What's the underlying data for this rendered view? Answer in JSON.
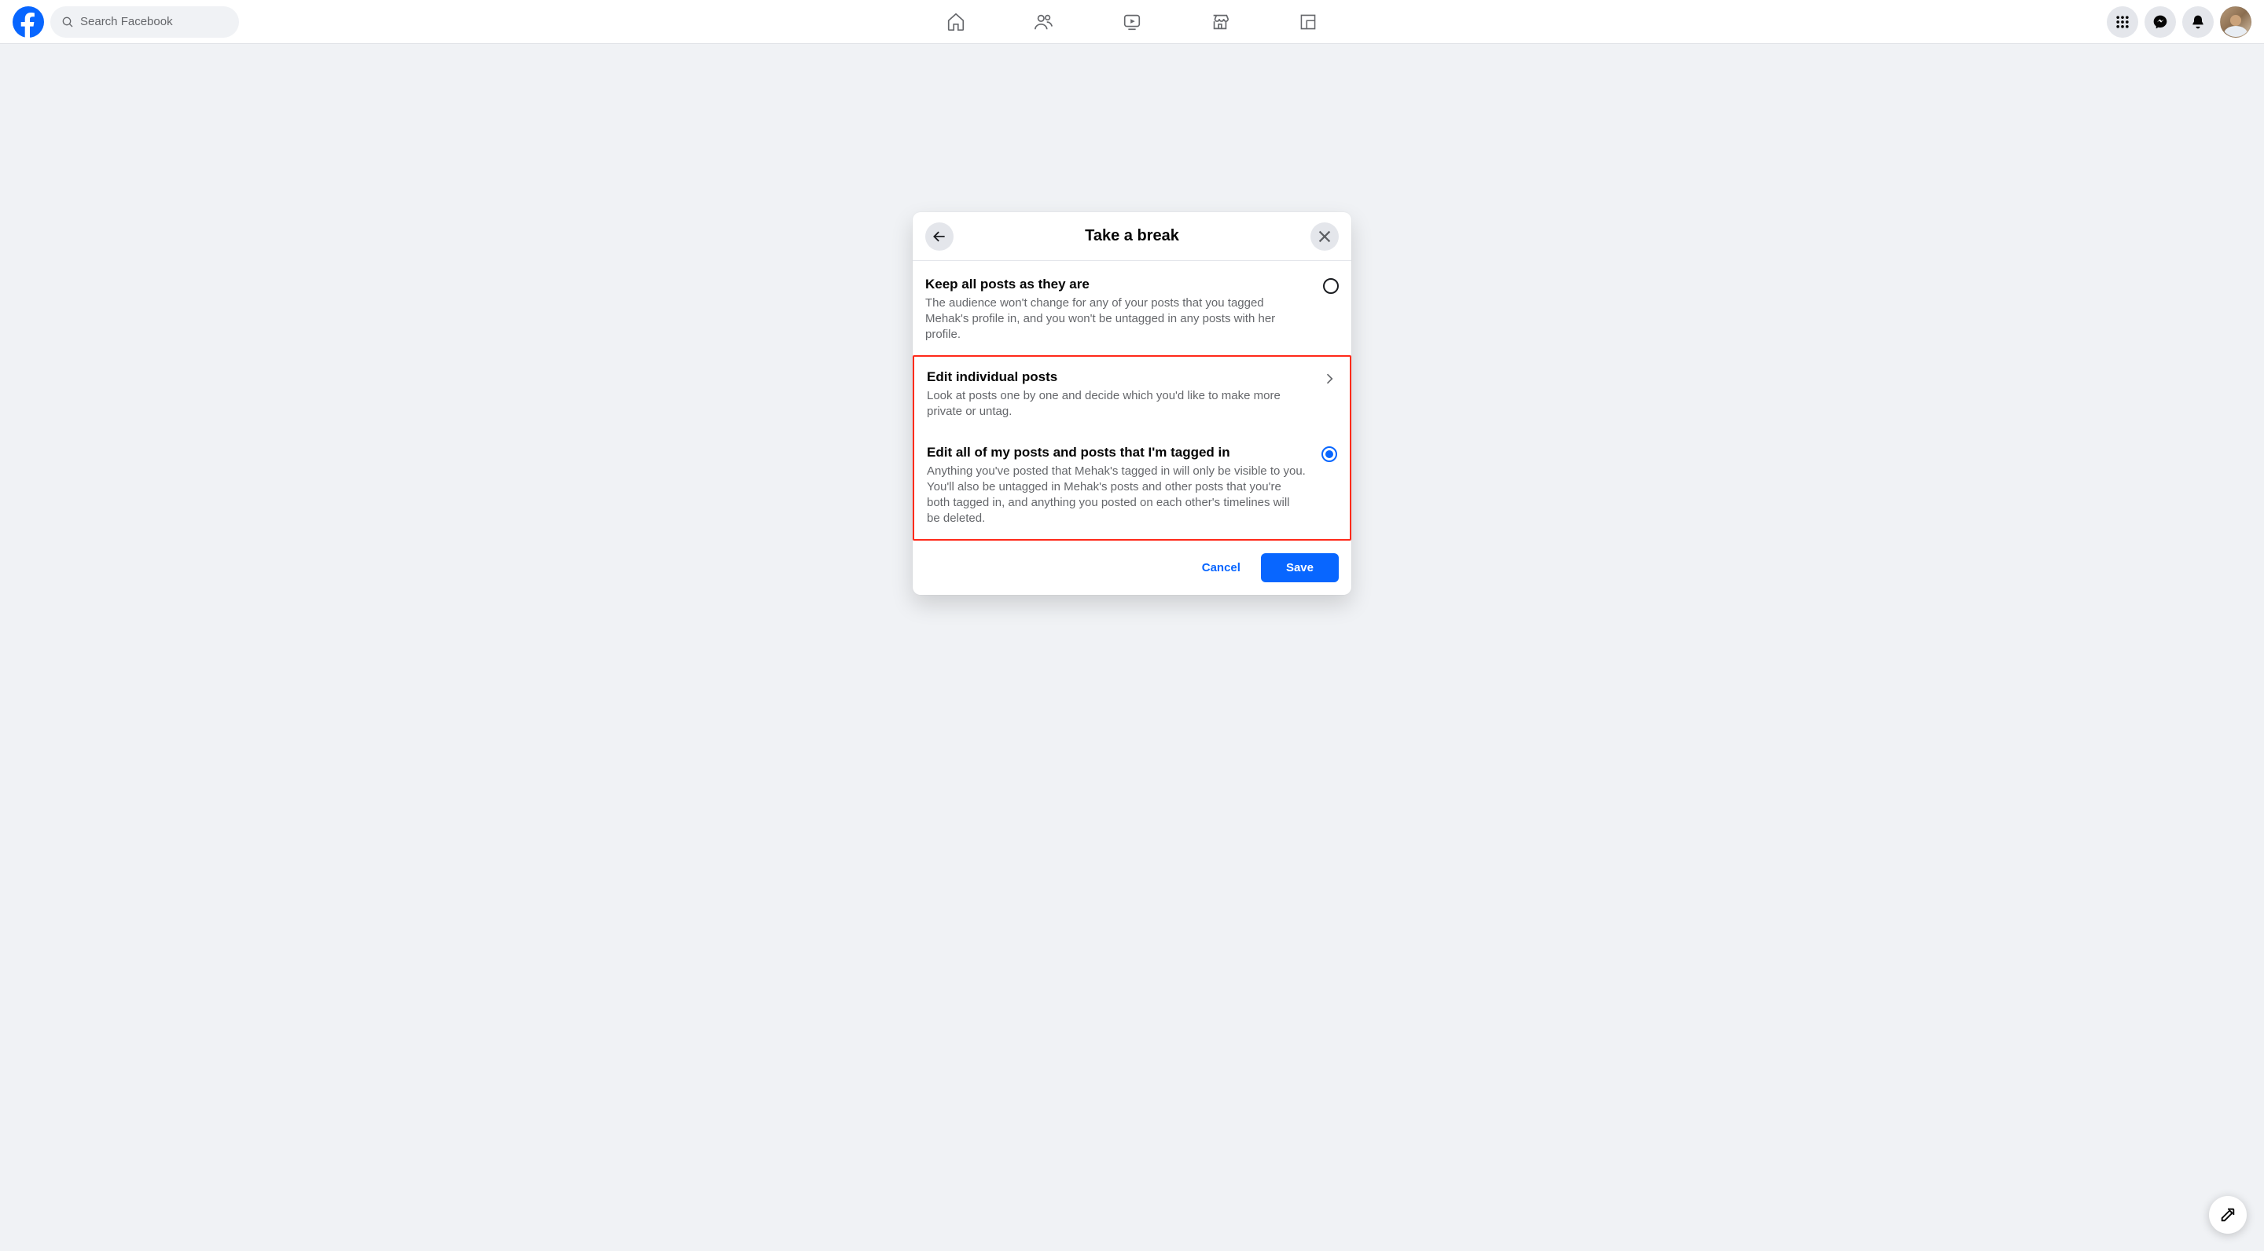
{
  "header": {
    "search_placeholder": "Search Facebook"
  },
  "dialog": {
    "title": "Take a break",
    "options": [
      {
        "title": "Keep all posts as they are",
        "desc": "The audience won't change for any of your posts that you tagged Mehak's profile in, and you won't be untagged in any posts with her profile.",
        "control": "radio",
        "selected": false
      },
      {
        "title": "Edit individual posts",
        "desc": "Look at posts one by one and decide which you'd like to make more private or untag.",
        "control": "chevron",
        "selected": false
      },
      {
        "title": "Edit all of my posts and posts that I'm tagged in",
        "desc": "Anything you've posted that Mehak's tagged in will only be visible to you. You'll also be untagged in Mehak's posts and other posts that you're both tagged in, and anything you posted on each other's timelines will be deleted.",
        "control": "radio",
        "selected": true
      }
    ],
    "cancel_label": "Cancel",
    "save_label": "Save"
  }
}
